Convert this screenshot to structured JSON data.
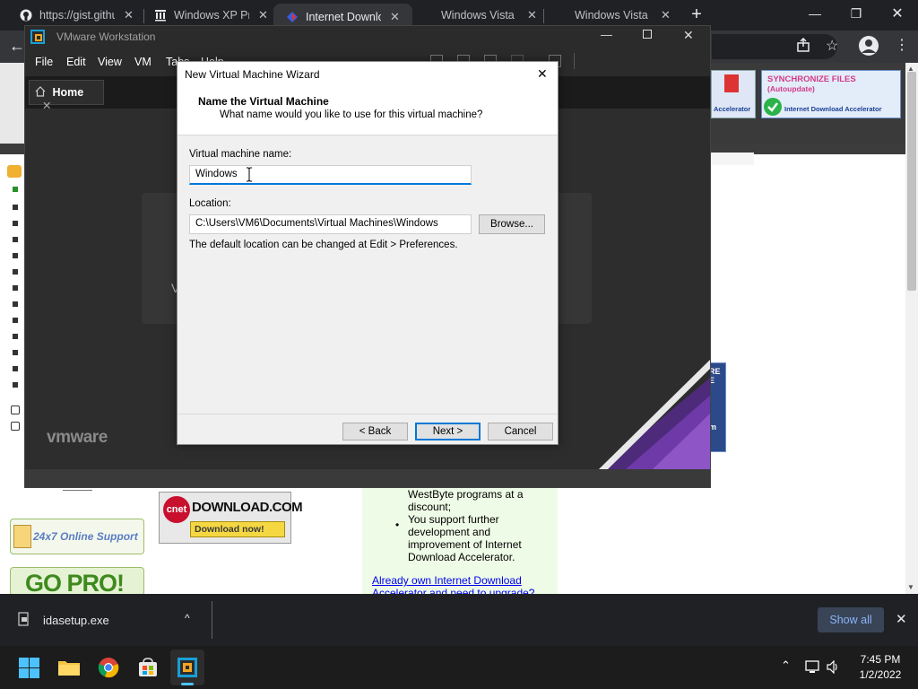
{
  "browser": {
    "tabs": [
      {
        "title": "https://gist.githu",
        "icon": "github-icon"
      },
      {
        "title": "Windows XP Pr",
        "icon": "archive-icon"
      },
      {
        "title": "Internet Downlo",
        "icon": "ida-icon"
      },
      {
        "title": "Windows Vista",
        "icon": "blank-icon"
      },
      {
        "title": "Windows Vista",
        "icon": "blank-icon"
      }
    ],
    "new_tab": "+",
    "minimize": "—",
    "restore": "❐",
    "close": "✕"
  },
  "webpage": {
    "sync_banner_line1": "SYNCHRONIZE FILES",
    "sync_banner_line2": "(Autoupdate)",
    "sync_banner_line3": "Internet Download Accelerator",
    "ad_small_label": "Accelerator",
    "lang": "eng",
    "support_label": "24x7 Online Support",
    "gopro_label": "GO PRO!",
    "cnet_logo": "cnet",
    "cnet_download": "DOWNLOAD.COM",
    "cnet_download_now": "Download now!",
    "list_frag": "WestByte programs at a discount;",
    "list_item": "You support further development and improvement of Internet Download Accelerator.",
    "link_text": "Already own Internet Download Accelerator and need to upgrade?",
    "side_text_1": "RE",
    "side_text_2": "E",
    "side_text_3": "m"
  },
  "vmware": {
    "title": "VMware Workstation",
    "menu": [
      "File",
      "Edit",
      "View",
      "VM",
      "Tabs",
      "Help"
    ],
    "home_tab": "Home",
    "logo": "vmware",
    "partial_letter": "V"
  },
  "dialog": {
    "title": "New Virtual Machine Wizard",
    "heading": "Name the Virtual Machine",
    "subheading": "What name would you like to use for this virtual machine?",
    "name_label": "Virtual machine name:",
    "name_value": "Windows",
    "location_label": "Location:",
    "location_value": "C:\\Users\\VM6\\Documents\\Virtual Machines\\Windows",
    "browse_label": "Browse...",
    "hint": "The default location can be changed at Edit > Preferences.",
    "back_label": "< Back",
    "next_label": "Next >",
    "cancel_label": "Cancel"
  },
  "download_bar": {
    "filename": "idasetup.exe",
    "show_all": "Show all"
  },
  "taskbar": {
    "time": "7:45 PM",
    "date": "1/2/2022"
  },
  "colors": {
    "accent": "#0078d7",
    "link": "#0000ee",
    "chrome_dark": "#202124",
    "vmware_dark": "#1f1f1f"
  }
}
